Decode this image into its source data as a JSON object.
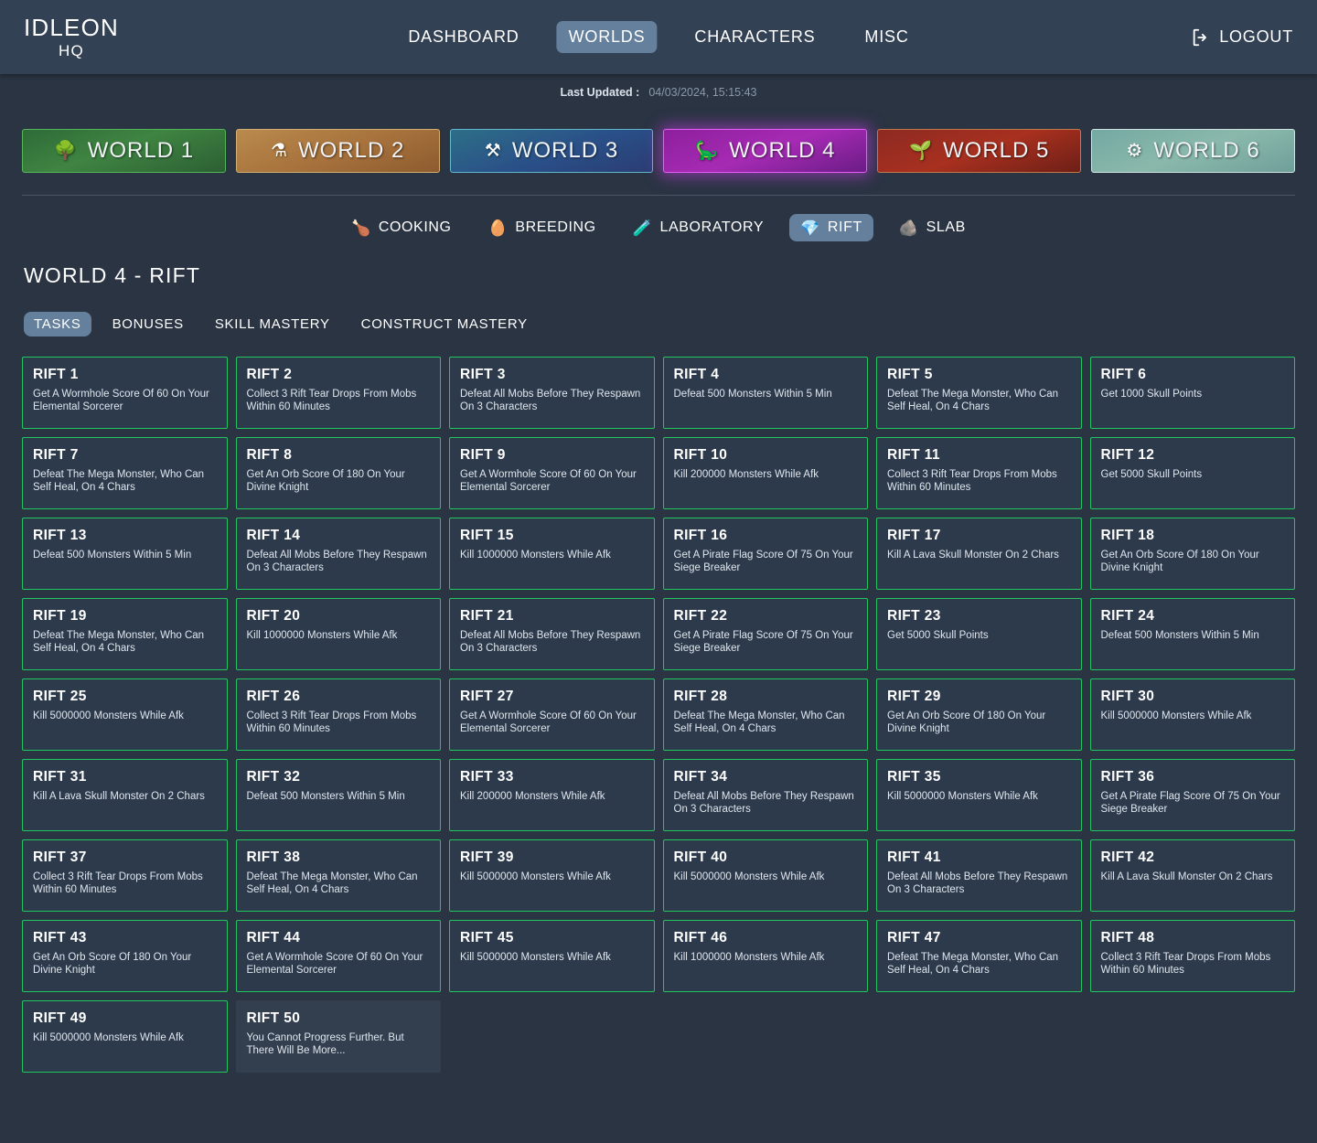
{
  "header": {
    "brand_main": "IDLEON",
    "brand_sub": "HQ",
    "nav": [
      {
        "label": "DASHBOARD",
        "active": false
      },
      {
        "label": "WORLDS",
        "active": true
      },
      {
        "label": "CHARACTERS",
        "active": false
      },
      {
        "label": "MISC",
        "active": false
      }
    ],
    "logout_label": "LOGOUT",
    "logout_icon": "logout-icon"
  },
  "updated": {
    "label": "Last Updated :",
    "value": "04/03/2024, 15:15:43"
  },
  "worlds": [
    {
      "label": "WORLD 1",
      "icon": "🌳",
      "icon_name": "world1-tree-icon",
      "active": false
    },
    {
      "label": "WORLD 2",
      "icon": "⚗",
      "icon_name": "world2-cauldron-icon",
      "active": false
    },
    {
      "label": "WORLD 3",
      "icon": "⚒",
      "icon_name": "world3-hammer-skull-icon",
      "active": false
    },
    {
      "label": "WORLD 4",
      "icon": "🦕",
      "icon_name": "world4-dino-icon",
      "active": true
    },
    {
      "label": "WORLD 5",
      "icon": "🌱",
      "icon_name": "world5-sprout-icon",
      "active": false
    },
    {
      "label": "WORLD 6",
      "icon": "⚙",
      "icon_name": "world6-gear-icon",
      "active": false
    }
  ],
  "subnav": [
    {
      "label": "COOKING",
      "icon": "🍗",
      "icon_name": "cooking-icon",
      "active": false
    },
    {
      "label": "BREEDING",
      "icon": "🥚",
      "icon_name": "breeding-egg-icon",
      "active": false
    },
    {
      "label": "LABORATORY",
      "icon": "🧪",
      "icon_name": "laboratory-flask-icon",
      "active": false
    },
    {
      "label": "RIFT",
      "icon": "💎",
      "icon_name": "rift-crystal-icon",
      "active": true
    },
    {
      "label": "SLAB",
      "icon": "🪨",
      "icon_name": "slab-rock-icon",
      "active": false
    }
  ],
  "page": {
    "title": "WORLD 4 - RIFT",
    "tabs": [
      {
        "label": "TASKS",
        "active": true
      },
      {
        "label": "BONUSES",
        "active": false
      },
      {
        "label": "SKILL MASTERY",
        "active": false
      },
      {
        "label": "CONSTRUCT MASTERY",
        "active": false
      }
    ]
  },
  "colors": {
    "page_background": "#2a3443",
    "topbar_background": "#334155",
    "accent_active": "#64809c",
    "card_background": "#2d3a4b",
    "card_border_complete": "#22c55e",
    "card_background_locked": "#333f4f"
  },
  "rifts": [
    {
      "title": "RIFT 1",
      "desc": "Get A Wormhole Score Of 60 On Your Elemental Sorcerer",
      "complete": true
    },
    {
      "title": "RIFT 2",
      "desc": "Collect 3 Rift Tear Drops From Mobs Within 60 Minutes",
      "complete": true
    },
    {
      "title": "RIFT 3",
      "desc": "Defeat All Mobs Before They Respawn On 3 Characters",
      "complete": true
    },
    {
      "title": "RIFT 4",
      "desc": "Defeat 500 Monsters Within 5 Min",
      "complete": true
    },
    {
      "title": "RIFT 5",
      "desc": "Defeat The Mega Monster, Who Can Self Heal, On 4 Chars",
      "complete": true
    },
    {
      "title": "RIFT 6",
      "desc": "Get 1000 Skull Points",
      "complete": true
    },
    {
      "title": "RIFT 7",
      "desc": "Defeat The Mega Monster, Who Can Self Heal, On 4 Chars",
      "complete": true
    },
    {
      "title": "RIFT 8",
      "desc": "Get An Orb Score Of 180 On Your Divine Knight",
      "complete": true
    },
    {
      "title": "RIFT 9",
      "desc": "Get A Wormhole Score Of 60 On Your Elemental Sorcerer",
      "complete": true
    },
    {
      "title": "RIFT 10",
      "desc": "Kill 200000 Monsters While Afk",
      "complete": true
    },
    {
      "title": "RIFT 11",
      "desc": "Collect 3 Rift Tear Drops From Mobs Within 60 Minutes",
      "complete": true
    },
    {
      "title": "RIFT 12",
      "desc": "Get 5000 Skull Points",
      "complete": true
    },
    {
      "title": "RIFT 13",
      "desc": "Defeat 500 Monsters Within 5 Min",
      "complete": true
    },
    {
      "title": "RIFT 14",
      "desc": "Defeat All Mobs Before They Respawn On 3 Characters",
      "complete": true
    },
    {
      "title": "RIFT 15",
      "desc": "Kill 1000000 Monsters While Afk",
      "complete": true
    },
    {
      "title": "RIFT 16",
      "desc": "Get A Pirate Flag Score Of 75 On Your Siege Breaker",
      "complete": true
    },
    {
      "title": "RIFT 17",
      "desc": "Kill A Lava Skull Monster On 2 Chars",
      "complete": true
    },
    {
      "title": "RIFT 18",
      "desc": "Get An Orb Score Of 180 On Your Divine Knight",
      "complete": true
    },
    {
      "title": "RIFT 19",
      "desc": "Defeat The Mega Monster, Who Can Self Heal, On 4 Chars",
      "complete": true
    },
    {
      "title": "RIFT 20",
      "desc": "Kill 1000000 Monsters While Afk",
      "complete": true
    },
    {
      "title": "RIFT 21",
      "desc": "Defeat All Mobs Before They Respawn On 3 Characters",
      "complete": true
    },
    {
      "title": "RIFT 22",
      "desc": "Get A Pirate Flag Score Of 75 On Your Siege Breaker",
      "complete": true
    },
    {
      "title": "RIFT 23",
      "desc": "Get 5000 Skull Points",
      "complete": true
    },
    {
      "title": "RIFT 24",
      "desc": "Defeat 500 Monsters Within 5 Min",
      "complete": true
    },
    {
      "title": "RIFT 25",
      "desc": "Kill 5000000 Monsters While Afk",
      "complete": true
    },
    {
      "title": "RIFT 26",
      "desc": "Collect 3 Rift Tear Drops From Mobs Within 60 Minutes",
      "complete": true
    },
    {
      "title": "RIFT 27",
      "desc": "Get A Wormhole Score Of 60 On Your Elemental Sorcerer",
      "complete": true
    },
    {
      "title": "RIFT 28",
      "desc": "Defeat The Mega Monster, Who Can Self Heal, On 4 Chars",
      "complete": true
    },
    {
      "title": "RIFT 29",
      "desc": "Get An Orb Score Of 180 On Your Divine Knight",
      "complete": true
    },
    {
      "title": "RIFT 30",
      "desc": "Kill 5000000 Monsters While Afk",
      "complete": true
    },
    {
      "title": "RIFT 31",
      "desc": "Kill A Lava Skull Monster On 2 Chars",
      "complete": true
    },
    {
      "title": "RIFT 32",
      "desc": "Defeat 500 Monsters Within 5 Min",
      "complete": true
    },
    {
      "title": "RIFT 33",
      "desc": "Kill 200000 Monsters While Afk",
      "complete": true
    },
    {
      "title": "RIFT 34",
      "desc": "Defeat All Mobs Before They Respawn On 3 Characters",
      "complete": true
    },
    {
      "title": "RIFT 35",
      "desc": "Kill 5000000 Monsters While Afk",
      "complete": true
    },
    {
      "title": "RIFT 36",
      "desc": "Get A Pirate Flag Score Of 75 On Your Siege Breaker",
      "complete": true
    },
    {
      "title": "RIFT 37",
      "desc": "Collect 3 Rift Tear Drops From Mobs Within 60 Minutes",
      "complete": true
    },
    {
      "title": "RIFT 38",
      "desc": "Defeat The Mega Monster, Who Can Self Heal, On 4 Chars",
      "complete": true
    },
    {
      "title": "RIFT 39",
      "desc": "Kill 5000000 Monsters While Afk",
      "complete": true
    },
    {
      "title": "RIFT 40",
      "desc": "Kill 5000000 Monsters While Afk",
      "complete": true
    },
    {
      "title": "RIFT 41",
      "desc": "Defeat All Mobs Before They Respawn On 3 Characters",
      "complete": true
    },
    {
      "title": "RIFT 42",
      "desc": "Kill A Lava Skull Monster On 2 Chars",
      "complete": true
    },
    {
      "title": "RIFT 43",
      "desc": "Get An Orb Score Of 180 On Your Divine Knight",
      "complete": true
    },
    {
      "title": "RIFT 44",
      "desc": "Get A Wormhole Score Of 60 On Your Elemental Sorcerer",
      "complete": true
    },
    {
      "title": "RIFT 45",
      "desc": "Kill 5000000 Monsters While Afk",
      "complete": true
    },
    {
      "title": "RIFT 46",
      "desc": "Kill 1000000 Monsters While Afk",
      "complete": true
    },
    {
      "title": "RIFT 47",
      "desc": "Defeat The Mega Monster, Who Can Self Heal, On 4 Chars",
      "complete": true
    },
    {
      "title": "RIFT 48",
      "desc": "Collect 3 Rift Tear Drops From Mobs Within 60 Minutes",
      "complete": true
    },
    {
      "title": "RIFT 49",
      "desc": "Kill 5000000 Monsters While Afk",
      "complete": true
    },
    {
      "title": "RIFT 50",
      "desc": "You Cannot Progress Further. But There Will Be More...",
      "complete": false
    }
  ]
}
